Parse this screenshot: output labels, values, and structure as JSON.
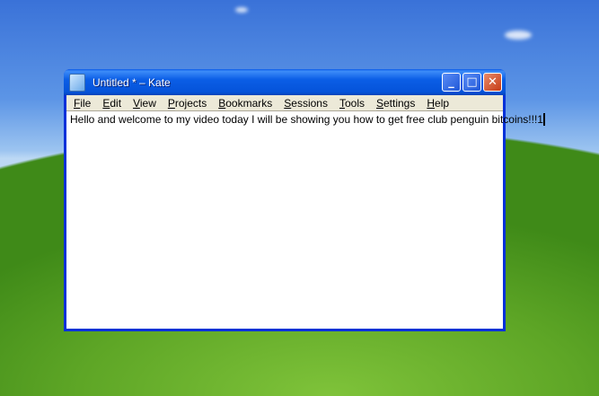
{
  "window": {
    "title": "Untitled * – Kate"
  },
  "menu": [
    "File",
    "Edit",
    "View",
    "Projects",
    "Bookmarks",
    "Sessions",
    "Tools",
    "Settings",
    "Help"
  ],
  "editor": {
    "text": "Hello and welcome to my video today I will be showing you how to get free club penguin bitcoins!!!1"
  }
}
